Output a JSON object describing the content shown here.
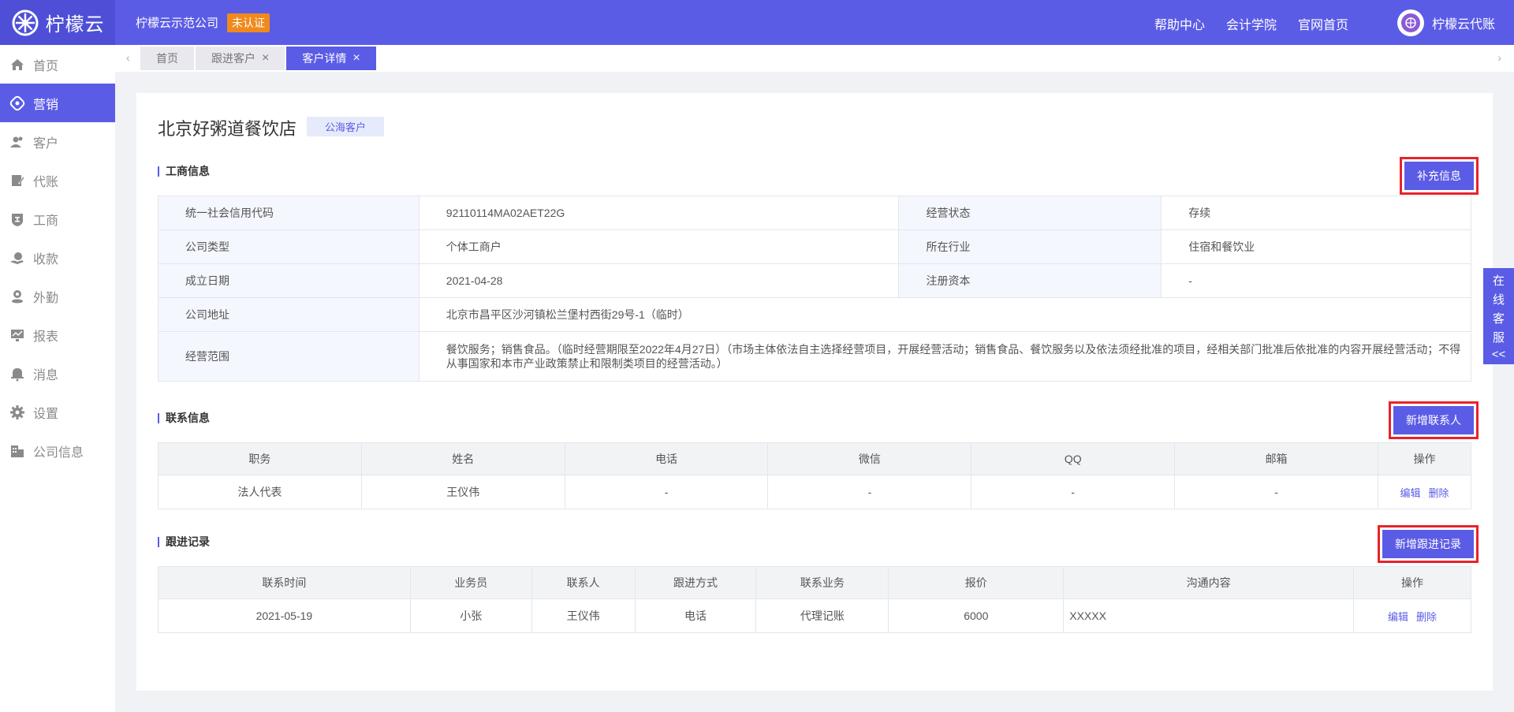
{
  "header": {
    "logo_text": "柠檬云",
    "company_name": "柠檬云示范公司",
    "auth_badge": "未认证",
    "links": [
      "帮助中心",
      "会计学院",
      "官网首页"
    ],
    "user_name": "柠檬云代账",
    "accent_color": "#5b5ce6"
  },
  "sidebar": {
    "items": [
      {
        "label": "首页",
        "icon": "home-icon"
      },
      {
        "label": "营销",
        "icon": "marketing-icon"
      },
      {
        "label": "客户",
        "icon": "customers-icon"
      },
      {
        "label": "代账",
        "icon": "bookkeeping-icon"
      },
      {
        "label": "工商",
        "icon": "business-icon"
      },
      {
        "label": "收款",
        "icon": "payment-icon"
      },
      {
        "label": "外勤",
        "icon": "field-icon"
      },
      {
        "label": "报表",
        "icon": "report-icon"
      },
      {
        "label": "消息",
        "icon": "bell-icon"
      },
      {
        "label": "设置",
        "icon": "gear-icon"
      },
      {
        "label": "公司信息",
        "icon": "building-icon"
      }
    ],
    "active_index": 1
  },
  "tabs": [
    {
      "label": "首页",
      "closable": false
    },
    {
      "label": "跟进客户",
      "closable": true
    },
    {
      "label": "客户详情",
      "closable": true
    }
  ],
  "customer": {
    "name": "北京好粥道餐饮店",
    "tag": "公海客户"
  },
  "business_info": {
    "title": "工商信息",
    "button": "补充信息",
    "credit_code_label": "统一社会信用代码",
    "credit_code": "92110114MA02AET22G",
    "status_label": "经营状态",
    "status": "存续",
    "company_type_label": "公司类型",
    "company_type": "个体工商户",
    "industry_label": "所在行业",
    "industry": "住宿和餐饮业",
    "founded_label": "成立日期",
    "founded": "2021-04-28",
    "capital_label": "注册资本",
    "capital": "-",
    "address_label": "公司地址",
    "address": "北京市昌平区沙河镇松兰堡村西街29号-1（临时）",
    "scope_label": "经营范围",
    "scope": "餐饮服务；销售食品。（临时经营期限至2022年4月27日）（市场主体依法自主选择经营项目，开展经营活动；销售食品、餐饮服务以及依法须经批准的项目，经相关部门批准后依批准的内容开展经营活动；不得从事国家和本市产业政策禁止和限制类项目的经营活动。）"
  },
  "contact_info": {
    "title": "联系信息",
    "button": "新增联系人",
    "headers": [
      "职务",
      "姓名",
      "电话",
      "微信",
      "QQ",
      "邮箱",
      "操作"
    ],
    "rows": [
      {
        "position": "法人代表",
        "name": "王仪伟",
        "phone": "-",
        "wechat": "-",
        "qq": "-",
        "email": "-"
      }
    ],
    "edit": "编辑",
    "delete": "删除"
  },
  "followup": {
    "title": "跟进记录",
    "button": "新增跟进记录",
    "headers": [
      "联系时间",
      "业务员",
      "联系人",
      "跟进方式",
      "联系业务",
      "报价",
      "沟通内容",
      "操作"
    ],
    "rows": [
      {
        "time": "2021-05-19",
        "salesman": "小张",
        "contact": "王仪伟",
        "method": "电话",
        "business": "代理记账",
        "price": "6000",
        "content": "XXXXX"
      }
    ],
    "edit": "编辑",
    "delete": "删除"
  },
  "float_service": {
    "chars": [
      "在",
      "线",
      "客",
      "服"
    ],
    "arrow": "<<"
  }
}
